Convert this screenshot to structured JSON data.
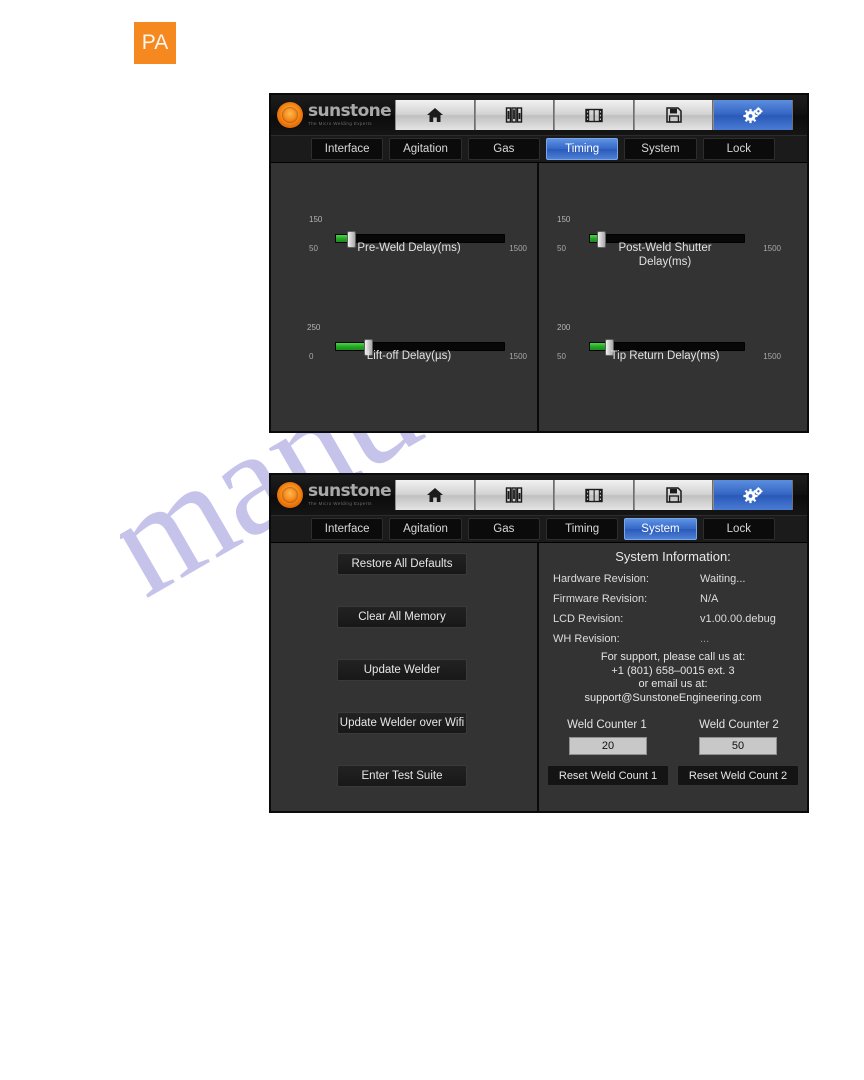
{
  "page": {
    "corner_logo": "PA",
    "watermark": "manualslive.com"
  },
  "brand": {
    "name": "sunstone",
    "tagline": "The Micro Welding Experts",
    "logo_icon": "sun-burst-icon"
  },
  "toolbar": {
    "buttons": [
      {
        "name": "home",
        "icon": "home-icon",
        "active": false
      },
      {
        "name": "sliders",
        "icon": "sliders-icon",
        "active": false
      },
      {
        "name": "film",
        "icon": "film-icon",
        "active": false
      },
      {
        "name": "save",
        "icon": "save-icon",
        "active": false
      },
      {
        "name": "settings",
        "icon": "gears-icon",
        "active": true
      }
    ]
  },
  "tabs": [
    "Interface",
    "Agitation",
    "Gas",
    "Timing",
    "System",
    "Lock"
  ],
  "screen_timing": {
    "active_tab": "Timing",
    "sliders": [
      {
        "label": "Pre-Weld Delay(ms)",
        "value": "150",
        "min": "50",
        "max": "1500",
        "percent": 8
      },
      {
        "label": "Lift-off Delay(µs)",
        "value": "250",
        "min": "0",
        "max": "1500",
        "percent": 18
      },
      {
        "label": "Post-Weld Shutter Delay(ms)",
        "value": "150",
        "min": "50",
        "max": "1500",
        "percent": 6
      },
      {
        "label": "Tip Return Delay(ms)",
        "value": "200",
        "min": "50",
        "max": "1500",
        "percent": 11
      }
    ]
  },
  "screen_system": {
    "active_tab": "System",
    "actions": [
      "Restore All Defaults",
      "Clear All Memory",
      "Update Welder",
      "Update Welder over Wifi",
      "Enter Test Suite"
    ],
    "info_title": "System Information:",
    "info_rows": [
      {
        "key": "Hardware Revision:",
        "value": "Waiting..."
      },
      {
        "key": "Firmware Revision:",
        "value": "N/A"
      },
      {
        "key": "LCD Revision:",
        "value": "v1.00.00.debug"
      },
      {
        "key": "WH Revision:",
        "value": "..."
      }
    ],
    "support_lines": [
      "For support, please call us at:",
      "+1 (801) 658–0015 ext. 3",
      "or email us at:",
      "support@SunstoneEngineering.com"
    ],
    "counters": [
      {
        "label": "Weld Counter 1",
        "value": "20",
        "reset_label": "Reset Weld Count 1"
      },
      {
        "label": "Weld Counter 2",
        "value": "50",
        "reset_label": "Reset Weld Count 2"
      }
    ]
  },
  "colors": {
    "accent_blue": "#3568c7",
    "brand_orange": "#f5881f",
    "slider_green": "#22a522",
    "panel_bg": "#333333"
  }
}
